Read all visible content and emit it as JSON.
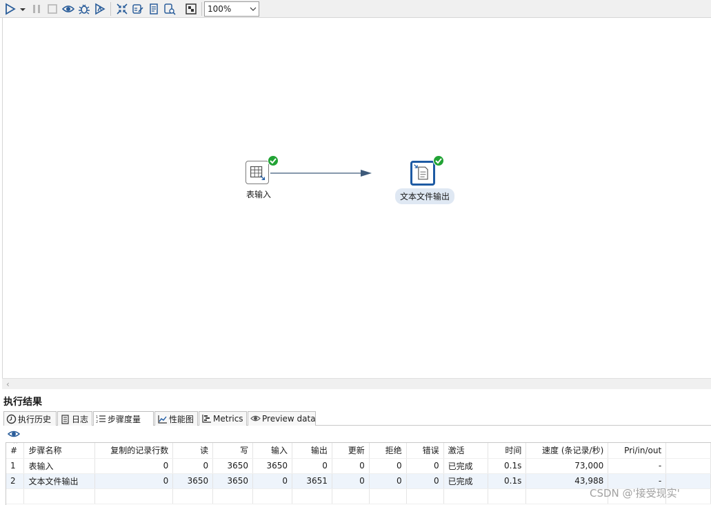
{
  "toolbar": {
    "buttons": [
      {
        "icon": "run-icon"
      },
      {
        "icon": "run-dropdown-icon"
      },
      {
        "icon": "pause-icon"
      },
      {
        "icon": "stop-icon"
      },
      {
        "icon": "preview-icon"
      },
      {
        "icon": "debug-icon"
      },
      {
        "icon": "replay-icon"
      },
      {
        "icon": "check-transformation-icon"
      },
      {
        "icon": "impact-analysis-icon"
      },
      {
        "icon": "sql-icon"
      },
      {
        "icon": "explore-db-icon"
      },
      {
        "icon": "show-results-icon"
      }
    ],
    "zoom": "100%"
  },
  "canvas": {
    "nodes": [
      {
        "label": "表输入",
        "icon": "table-input-icon",
        "status": "success"
      },
      {
        "label": "文本文件输出",
        "icon": "text-file-output-icon",
        "status": "success"
      }
    ],
    "hop_color": "#3d5a7a"
  },
  "results": {
    "title": "执行结果",
    "tabs": [
      {
        "label": "执行历史",
        "icon": "clock-icon"
      },
      {
        "label": "日志",
        "icon": "log-icon"
      },
      {
        "label": "步骤度量",
        "icon": "metrics-list-icon",
        "active": true
      },
      {
        "label": "性能图",
        "icon": "performance-chart-icon"
      },
      {
        "label": "Metrics",
        "icon": "gantt-icon"
      },
      {
        "label": "Preview data",
        "icon": "eye-icon"
      }
    ],
    "columns": [
      "#",
      "步骤名称",
      "复制的记录行数",
      "读",
      "写",
      "输入",
      "输出",
      "更新",
      "拒绝",
      "错误",
      "激活",
      "时间",
      "速度 (条记录/秒)",
      "Pri/in/out"
    ],
    "rows": [
      [
        "1",
        "表输入",
        "0",
        "0",
        "3650",
        "3650",
        "0",
        "0",
        "0",
        "0",
        "已完成",
        "0.1s",
        "73,000",
        "-"
      ],
      [
        "2",
        "文本文件输出",
        "0",
        "3650",
        "3650",
        "0",
        "3651",
        "0",
        "0",
        "0",
        "已完成",
        "0.1s",
        "43,988",
        "-"
      ]
    ]
  },
  "watermark": "CSDN @'接受现实'"
}
